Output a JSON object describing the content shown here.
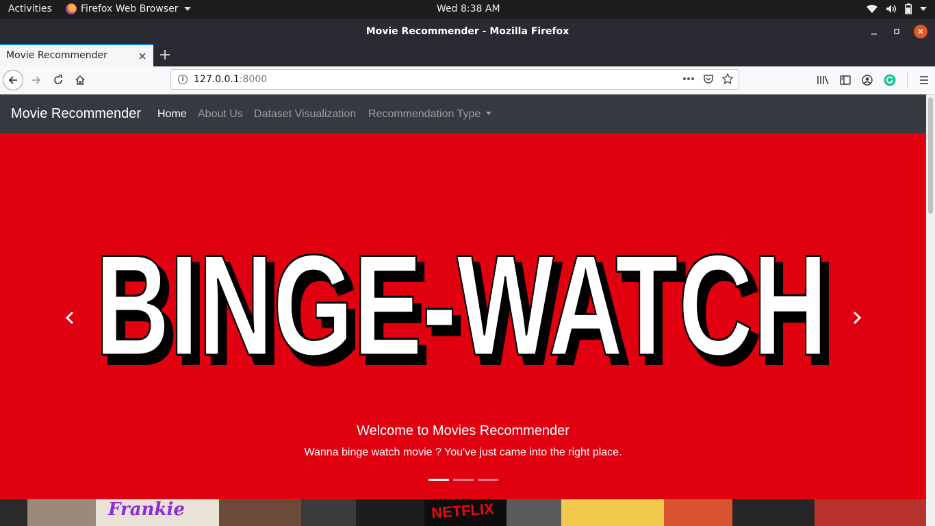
{
  "system_bar": {
    "activities": "Activities",
    "app_name": "Firefox Web Browser",
    "clock": "Wed  8:38 AM"
  },
  "window": {
    "title": "Movie Recommender - Mozilla Firefox"
  },
  "browser": {
    "tab_label": "Movie Recommender",
    "url_host": "127.0.0.1",
    "url_port": ":8000"
  },
  "site": {
    "brand": "Movie Recommender",
    "nav": {
      "home": "Home",
      "about": "About Us",
      "visualization": "Dataset Visualization",
      "recommendation_type": "Recommendation Type"
    }
  },
  "carousel": {
    "banner_text": "BINGE-WATCH",
    "caption_title": "Welcome to Movies Recommender",
    "caption_text": "Wanna binge watch movie ? You've just came into the right place.",
    "active_slide": 1,
    "slide_count": 3,
    "background_color": "#e1000f"
  },
  "poster_strip": {
    "labels": [
      "Frankie",
      "NETFLIX"
    ]
  },
  "icons": [
    "firefox-icon",
    "wifi-icon",
    "volume-icon",
    "battery-icon",
    "back-icon",
    "forward-icon",
    "reload-icon",
    "home-icon",
    "info-icon",
    "more-icon",
    "pocket-icon",
    "star-icon",
    "library-icon",
    "sidebar-icon",
    "account-icon",
    "grammarly-icon",
    "menu-icon",
    "prev-icon",
    "next-icon"
  ]
}
